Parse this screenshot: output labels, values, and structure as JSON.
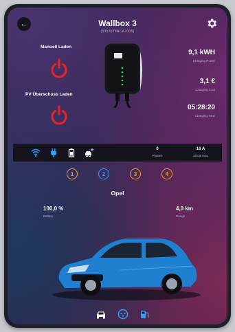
{
  "header": {
    "title": "Wallbox 3",
    "subtitle": "(0353578ACA7005)"
  },
  "controls": {
    "manual_label": "Manuell Laden",
    "pv_label": "PV Überschuss Laden"
  },
  "stats": [
    {
      "value": "9,1 kWH",
      "label": "Charging Power"
    },
    {
      "value": "3,1 €",
      "label": "Charging Cost"
    },
    {
      "value": "05:28:20",
      "label": "Charging Time"
    }
  ],
  "status_bar": {
    "icons": [
      "wifi-icon",
      "plug-icon",
      "battery-icon",
      "car-wifi-icon"
    ],
    "phases": {
      "value": "0",
      "label": "Phases"
    },
    "actual_max": {
      "value": "16 A",
      "label": "actual max"
    }
  },
  "vehicle_tabs": [
    {
      "label": "1",
      "color": "#f0a020"
    },
    {
      "label": "2",
      "color": "#2aa0ff"
    },
    {
      "label": "3",
      "color": "#f0a020"
    },
    {
      "label": "4",
      "color": "#f0a020"
    }
  ],
  "vehicle": {
    "name": "Opel",
    "battery": {
      "value": "100,0 %",
      "label": "Battery"
    },
    "range": {
      "value": "4,0 km",
      "label": "Range"
    }
  },
  "bottom_nav": [
    "car-icon",
    "charger-icon",
    "fuel-icon"
  ],
  "colors": {
    "power_red": "#e3242b",
    "accent_blue": "#2aa0ff",
    "accent_orange": "#f0a020",
    "led_green": "#22e06a",
    "car_blue": "#1f7fd1"
  }
}
